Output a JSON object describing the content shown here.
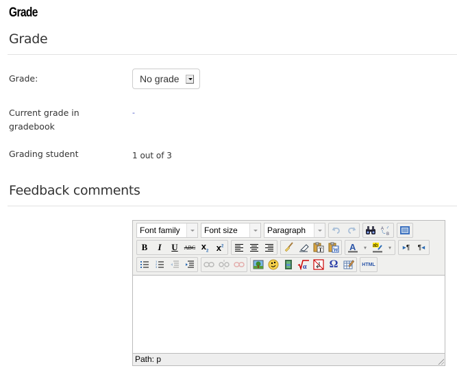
{
  "page_title": "Grade",
  "grade_section": {
    "title": "Grade",
    "fields": {
      "grade_label": "Grade:",
      "grade_select_value": "No grade",
      "current_grade_label": "Current grade in gradebook",
      "current_grade_value": "-",
      "grading_student_label": "Grading student",
      "grading_student_value": "1 out of 3"
    }
  },
  "feedback_section": {
    "title": "Feedback comments"
  },
  "editor": {
    "font_family": "Font family",
    "font_size": "Font size",
    "format": "Paragraph",
    "toolbar_rows": [
      [
        "font-family-select",
        "font-size-select",
        "format-select",
        "undo",
        "redo",
        "find",
        "replace",
        "fullscreen"
      ],
      [
        "bold",
        "italic",
        "underline",
        "strikethrough",
        "subscript",
        "superscript",
        "align-left",
        "align-center",
        "align-right",
        "clean-up",
        "remove-format",
        "paste-text",
        "paste-word",
        "text-color",
        "highlight-color",
        "ltr",
        "rtl"
      ],
      [
        "bullet-list",
        "numbered-list",
        "outdent",
        "indent",
        "link",
        "unlink",
        "unlink-anchor",
        "image",
        "emoticon",
        "media",
        "equation",
        "no-autolink",
        "special-char",
        "table",
        "html"
      ]
    ],
    "labels": {
      "bold": "B",
      "italic": "I",
      "underline": "U",
      "strikethrough": "ABC",
      "subscript": "x",
      "superscript": "x",
      "omega": "Ω",
      "html": "HTML"
    },
    "path_label": "Path: p"
  }
}
